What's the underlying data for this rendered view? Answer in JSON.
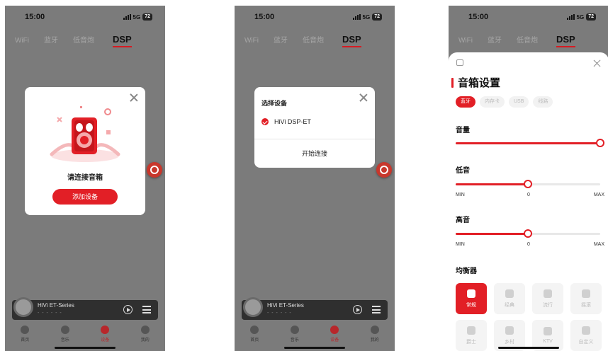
{
  "status": {
    "time": "15:00",
    "network": "5G",
    "battery": "72"
  },
  "tabs": [
    "WiFi",
    "蓝牙",
    "低音炮",
    "DSP"
  ],
  "active_tab": "DSP",
  "player": {
    "title": "HiVi ET-Series",
    "subtitle": "- - -  - - -"
  },
  "nav": [
    {
      "label": "首页",
      "active": false
    },
    {
      "label": "音乐",
      "active": false
    },
    {
      "label": "设备",
      "active": true
    },
    {
      "label": "我的",
      "active": false
    }
  ],
  "connect_dialog": {
    "message": "请连接音箱",
    "button": "添加设备"
  },
  "select_dialog": {
    "title": "选择设备",
    "device": "HiVi DSP-ET",
    "connect": "开始连接"
  },
  "speaker_settings": {
    "title": "音箱设置",
    "sources": [
      "蓝牙",
      "内存卡",
      "USB",
      "线路"
    ],
    "active_source": "蓝牙",
    "volume": {
      "label": "音量",
      "value": 1.0
    },
    "bass": {
      "label": "低音",
      "min": "MIN",
      "mid": "0",
      "max": "MAX",
      "value": 0.5
    },
    "treble": {
      "label": "高音",
      "min": "MIN",
      "mid": "0",
      "max": "MAX",
      "value": 0.5
    },
    "equalizer": {
      "label": "均衡器",
      "presets": [
        "常规",
        "经典",
        "流行",
        "摇滚",
        "爵士",
        "乡村",
        "KTV",
        "自定义"
      ],
      "active": "常规"
    }
  },
  "colors": {
    "accent": "#e21f26",
    "overlay": "#7b7b7b"
  }
}
